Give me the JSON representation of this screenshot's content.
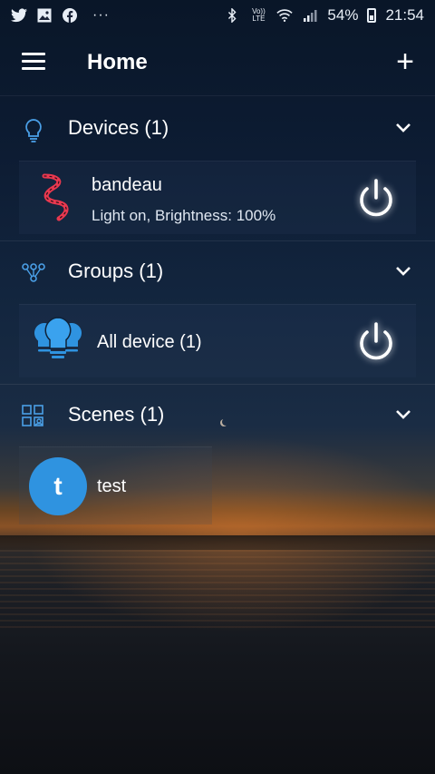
{
  "status_bar": {
    "left_icons": [
      "twitter-icon",
      "gallery-icon",
      "facebook-icon"
    ],
    "more": "···",
    "volte": "Vo)) LTE",
    "battery": "54%",
    "time": "21:54"
  },
  "app_bar": {
    "title": "Home",
    "add_label": "+"
  },
  "sections": {
    "devices": {
      "title": "Devices (1)",
      "items": [
        {
          "name": "bandeau",
          "status": "Light on, Brightness: 100%"
        }
      ]
    },
    "groups": {
      "title": "Groups (1)",
      "items": [
        {
          "name": "All device (1)"
        }
      ]
    },
    "scenes": {
      "title": "Scenes (1)",
      "items": [
        {
          "initial": "t",
          "name": "test"
        }
      ]
    }
  },
  "colors": {
    "accent": "#2f93e0",
    "strip_icon": "#e8384f",
    "bulb_icon": "#2f93e0"
  }
}
